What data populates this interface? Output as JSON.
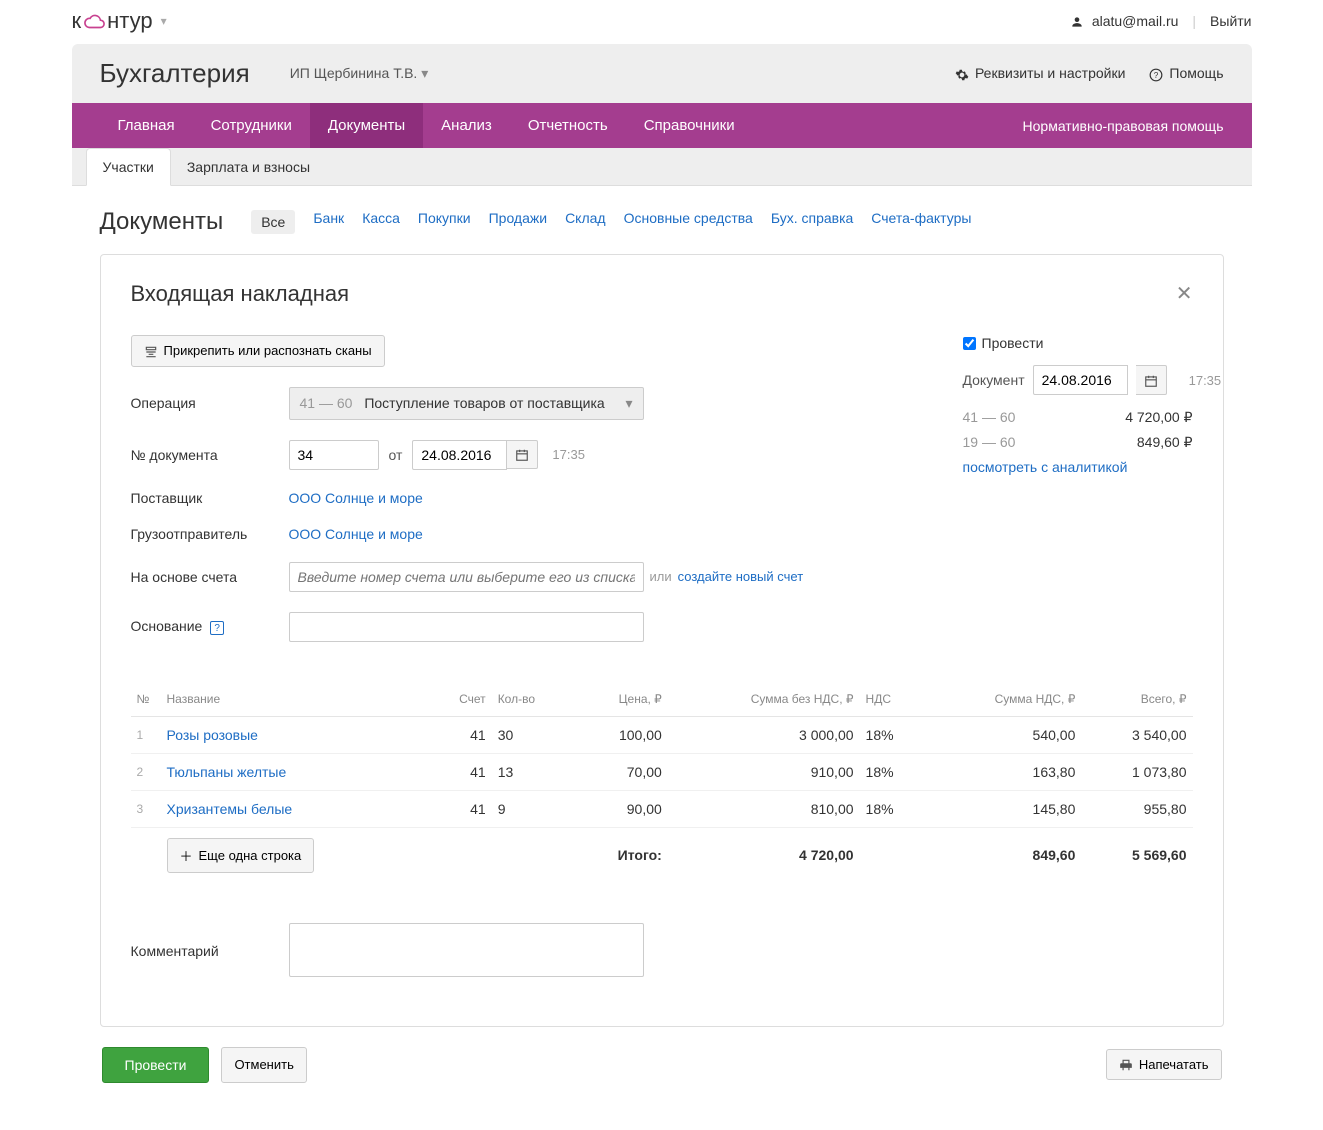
{
  "topbar": {
    "logo_parts": [
      "к",
      "нтур"
    ],
    "user_email": "alatu@mail.ru",
    "logout": "Выйти"
  },
  "header": {
    "app_title": "Бухгалтерия",
    "org_name": "ИП Щербинина Т.В.",
    "settings": "Реквизиты и настройки",
    "help": "Помощь"
  },
  "nav": {
    "items": [
      "Главная",
      "Сотрудники",
      "Документы",
      "Анализ",
      "Отчетность",
      "Справочники"
    ],
    "right": "Нормативно-правовая помощь"
  },
  "subtabs": [
    "Участки",
    "Зарплата и взносы"
  ],
  "section": {
    "title": "Документы",
    "filters": [
      "Все",
      "Банк",
      "Касса",
      "Покупки",
      "Продажи",
      "Склад",
      "Основные средства",
      "Бух. справка",
      "Счета-фактуры"
    ]
  },
  "card": {
    "title": "Входящая накладная",
    "attach_btn": "Прикрепить или распознать сканы",
    "labels": {
      "operation": "Операция",
      "doc_no": "№ документа",
      "from": "от",
      "supplier": "Поставщик",
      "shipper": "Грузоотправитель",
      "based_on": "На основе счета",
      "basis": "Основание",
      "comment": "Комментарий"
    },
    "operation": {
      "gray": "41 — 60",
      "text": "Поступление товаров от поставщика"
    },
    "doc_no_value": "34",
    "doc_date": "24.08.2016",
    "doc_time": "17:35",
    "supplier_value": "ООО Солнце и море",
    "shipper_value": "ООО Солнце и море",
    "based_on_placeholder": "Введите номер счета или выберите его из списка",
    "or_label": "или",
    "create_new": "создайте новый счет",
    "add_row": "Еще одна строка"
  },
  "summary": {
    "post_label": "Провести",
    "doc_label": "Документ",
    "doc_date": "24.08.2016",
    "doc_time": "17:35",
    "rows": [
      {
        "gray": "41 — 60",
        "val": "4 720,00 ₽"
      },
      {
        "gray": "19 — 60",
        "val": "849,60 ₽"
      }
    ],
    "analytics_link": "посмотреть с аналитикой"
  },
  "table": {
    "headers": [
      "№",
      "Название",
      "Счет",
      "Кол-во",
      "Цена, ₽",
      "Сумма без НДС, ₽",
      "НДС",
      "Сумма НДС, ₽",
      "Всего, ₽"
    ],
    "rows": [
      {
        "idx": "1",
        "name": "Розы розовые",
        "acct": "41",
        "qty": "30",
        "price": "100,00",
        "noVat": "3 000,00",
        "vatPct": "18%",
        "vatSum": "540,00",
        "total": "3 540,00"
      },
      {
        "idx": "2",
        "name": "Тюльпаны желтые",
        "acct": "41",
        "qty": "13",
        "price": "70,00",
        "noVat": "910,00",
        "vatPct": "18%",
        "vatSum": "163,80",
        "total": "1 073,80"
      },
      {
        "idx": "3",
        "name": "Хризантемы белые",
        "acct": "41",
        "qty": "9",
        "price": "90,00",
        "noVat": "810,00",
        "vatPct": "18%",
        "vatSum": "145,80",
        "total": "955,80"
      }
    ],
    "total_label": "Итого:",
    "totals": {
      "noVat": "4 720,00",
      "vatSum": "849,60",
      "total": "5 569,60"
    }
  },
  "footer": {
    "submit": "Провести",
    "cancel": "Отменить",
    "print": "Напечатать"
  }
}
